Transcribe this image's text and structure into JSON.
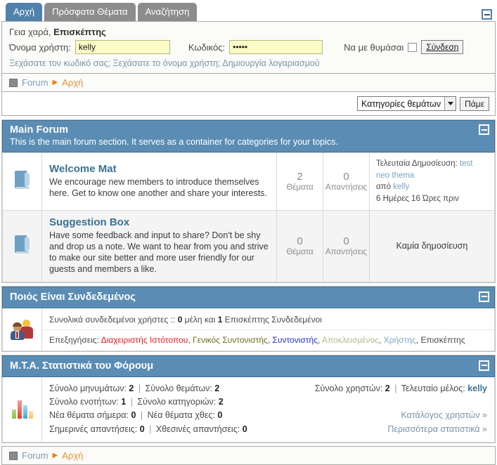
{
  "tabs": [
    {
      "label": "Αρχή",
      "active": true
    },
    {
      "label": "Πρόσφατα Θέματα",
      "active": false
    },
    {
      "label": "Αναζήτηση",
      "active": false
    }
  ],
  "login": {
    "greeting_prefix": "Γεια χαρά,",
    "guest_name": "Επισκέπτης",
    "username_label": "Όνομα χρήστη:",
    "username_value": "kelly",
    "username_placeholder": "",
    "password_label": "Κωδικός:",
    "password_value": "•••••",
    "password_placeholder": "",
    "remember_label": "Να με θυμάσαι",
    "remember_checked": false,
    "submit_label": "Σύνδεση",
    "forgot_password": "Ξεχάσατε τον κωδικό σας;",
    "forgot_username": "Ξεχάσατε το όνομα χρήστη;",
    "register": "Δημιουργία λογαριασμού"
  },
  "breadcrumb": {
    "root": "Forum",
    "arrow": "▶",
    "current": "Αρχή"
  },
  "jumpbar": {
    "selected_option": "Κατηγορίες θεμάτων",
    "go_label": "Πάμε"
  },
  "category": {
    "title": "Main Forum",
    "description": "This is the main forum section. It serves as a container for categories for your topics.",
    "forums": [
      {
        "name": "Welcome Mat",
        "description": "We encourage new members to introduce themselves here. Get to know one another and share your interests.",
        "topics": "2",
        "topics_label": "Θέματα",
        "replies": "0",
        "replies_label": "Απαντήσεις",
        "last_post_label": "Τελευταία Δημοσίευση:",
        "last_post_title": "test neo thema",
        "last_post_by_label": "από",
        "last_post_author": "kelly",
        "last_post_time": "6 Ημέρες 16 Ώρες πριν",
        "has_posts": true,
        "no_post_label": ""
      },
      {
        "name": "Suggestion Box",
        "description": "Have some feedback and input to share? Don't be shy and drop us a note. We want to hear from you and strive to make our site better and more user friendly for our guests and members a like.",
        "topics": "0",
        "topics_label": "Θέματα",
        "replies": "0",
        "replies_label": "Απαντήσεις",
        "last_post_label": "",
        "last_post_title": "",
        "last_post_by_label": "",
        "last_post_author": "",
        "last_post_time": "",
        "has_posts": false,
        "no_post_label": "Καμία δημοσίευση"
      }
    ]
  },
  "online": {
    "title": "Ποιός Είναι Συνδεδεμένος",
    "summary_prefix": "Συνολικά συνδεδεμένοι χρήστες ::",
    "members_count": "0",
    "members_word": "μέλη και",
    "guests_count": "1",
    "guests_word": "Επισκέπτης Συνδεδεμένοι",
    "legend_label": "Επεξηγήσεις:",
    "legend": [
      {
        "label": "Διαχειριστής Ιστότοπου",
        "color": "#e02020"
      },
      {
        "label": "Γενικός Συντονιστής",
        "color": "#6f6d1a"
      },
      {
        "label": "Συντονιστής",
        "color": "#2030d0"
      },
      {
        "label": "Αποκλεισμένος",
        "color": "#b5b98a"
      },
      {
        "label": "Χρήστης",
        "color": "#7ba6c9"
      },
      {
        "label": "Επισκέπτης",
        "color": "#4a4a4a"
      }
    ]
  },
  "stats": {
    "title": "Μ.Τ.Α. Στατιστικά του Φόρουμ",
    "total_messages_label": "Σύνολο μηνυμάτων:",
    "total_messages": "2",
    "total_topics_label": "Σύνολο θεμάτων:",
    "total_topics": "2",
    "total_sections_label": "Σύνολο ενοτήτων:",
    "total_sections": "1",
    "total_categories_label": "Σύνολο κατηγοριών:",
    "total_categories": "2",
    "new_topics_today_label": "Νέα θέματα σήμερα:",
    "new_topics_today": "0",
    "new_topics_yesterday_label": "Νέα θέματα χθες:",
    "new_topics_yesterday": "0",
    "replies_today_label": "Σημερινές απαντήσεις:",
    "replies_today": "0",
    "replies_yesterday_label": "Χθεσινές απαντήσεις:",
    "replies_yesterday": "0",
    "total_users_label": "Σύνολο χρηστών:",
    "total_users": "2",
    "last_member_label": "Τελευταίο μέλος:",
    "last_member": "kelly",
    "user_list_link": "Κατάλογος χρηστών »",
    "more_stats_link": "Περισσότερα στατιστικά »"
  },
  "icons": {
    "collapse": "minus-icon",
    "folder": "folder-icon",
    "people": "people-icon",
    "barchart": "bar-chart-icon",
    "crumb": "square-icon",
    "caret": "chevron-down-icon"
  },
  "colors": {
    "accent_blue": "#5b8db4",
    "tab_active": "#4f81ab",
    "tab_inactive": "#8c8c8c",
    "link": "#3b7196",
    "field_bg": "#fbfbc8"
  }
}
